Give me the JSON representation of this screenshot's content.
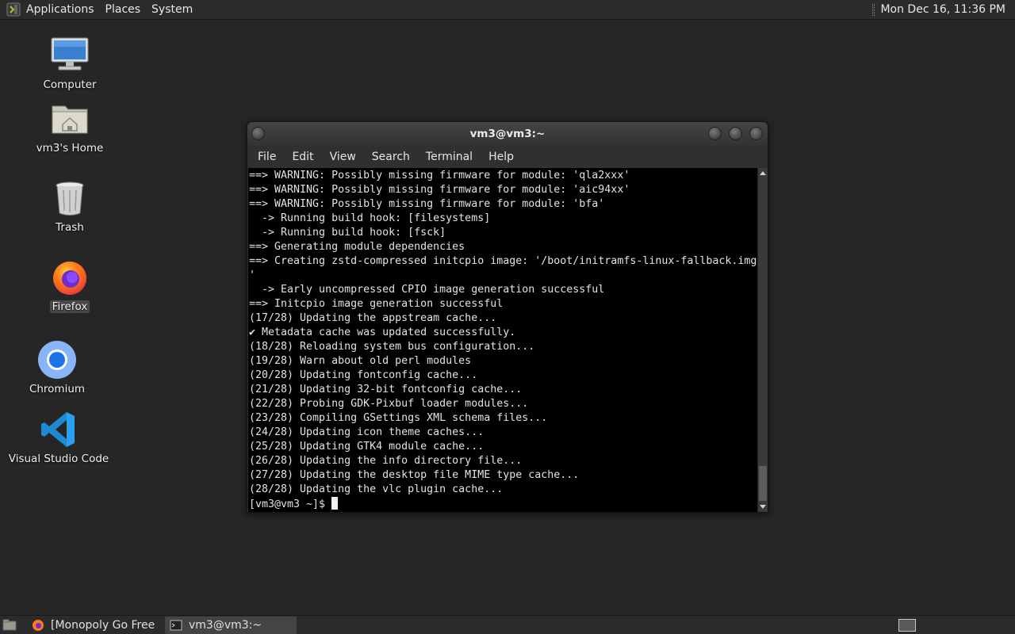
{
  "top_panel": {
    "menu": [
      "Applications",
      "Places",
      "System"
    ],
    "clock": "Mon Dec 16, 11:36 PM"
  },
  "desktop": {
    "icons": [
      {
        "label": "Computer",
        "icon": "computer-icon"
      },
      {
        "label": "vm3's Home",
        "icon": "home-folder-icon"
      },
      {
        "label": "Trash",
        "icon": "trash-icon"
      },
      {
        "label": "Firefox",
        "icon": "firefox-icon"
      },
      {
        "label": "Chromium",
        "icon": "chromium-icon"
      },
      {
        "label": "Visual Studio Code",
        "icon": "vscode-icon"
      }
    ]
  },
  "terminal": {
    "title": "vm3@vm3:~",
    "menu": [
      "File",
      "Edit",
      "View",
      "Search",
      "Terminal",
      "Help"
    ],
    "lines": [
      "==> WARNING: Possibly missing firmware for module: 'qla2xxx'",
      "==> WARNING: Possibly missing firmware for module: 'aic94xx'",
      "==> WARNING: Possibly missing firmware for module: 'bfa'",
      "  -> Running build hook: [filesystems]",
      "  -> Running build hook: [fsck]",
      "==> Generating module dependencies",
      "==> Creating zstd-compressed initcpio image: '/boot/initramfs-linux-fallback.img",
      "'",
      "  -> Early uncompressed CPIO image generation successful",
      "==> Initcpio image generation successful",
      "(17/28) Updating the appstream cache...",
      "✔ Metadata cache was updated successfully.",
      "(18/28) Reloading system bus configuration...",
      "(19/28) Warn about old perl modules",
      "(20/28) Updating fontconfig cache...",
      "(21/28) Updating 32-bit fontconfig cache...",
      "(22/28) Probing GDK-Pixbuf loader modules...",
      "(23/28) Compiling GSettings XML schema files...",
      "(24/28) Updating icon theme caches...",
      "(25/28) Updating GTK4 module cache...",
      "(26/28) Updating the info directory file...",
      "(27/28) Updating the desktop file MIME type cache...",
      "(28/28) Updating the vlc plugin cache..."
    ],
    "prompt": "[vm3@vm3 ~]$ "
  },
  "taskbar": {
    "tasks": [
      {
        "label": "[Monopoly Go Free ...",
        "icon": "firefox-icon",
        "active": false
      },
      {
        "label": "vm3@vm3:~",
        "icon": "terminal-icon",
        "active": true
      }
    ]
  }
}
